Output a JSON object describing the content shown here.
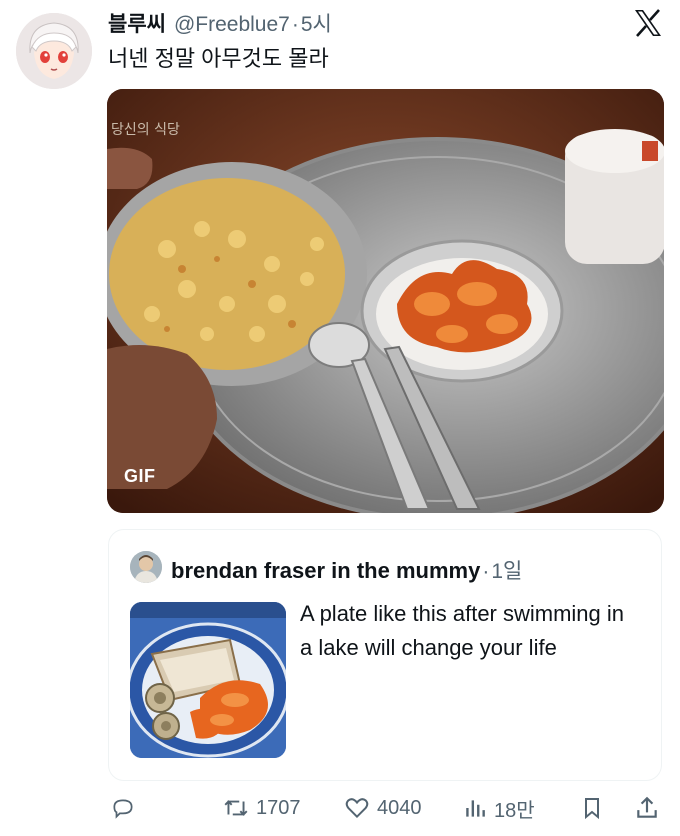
{
  "tweet": {
    "author_name": "블루씨",
    "handle": "@Freeblue7",
    "separator": "·",
    "time": "5시",
    "text": "너넨 정말 아무것도 몰라",
    "media_badge": "GIF",
    "media_caption_text": "당신의 식당"
  },
  "quoted": {
    "author_name": "brendan fraser in the mummy",
    "separator": "·",
    "time": "1일",
    "text": "A plate like this after swimming in a lake will change your life"
  },
  "actions": {
    "reply": {
      "icon": "reply-icon",
      "count": ""
    },
    "repost": {
      "icon": "repost-icon",
      "count": "1707"
    },
    "like": {
      "icon": "heart-icon",
      "count": "4040"
    },
    "views": {
      "icon": "views-icon",
      "count": "18만"
    },
    "bookmark": {
      "icon": "bookmark-icon"
    },
    "share": {
      "icon": "share-icon"
    }
  },
  "colors": {
    "text_primary": "#0f1419",
    "text_secondary": "#536471",
    "border": "#eff3f4"
  }
}
